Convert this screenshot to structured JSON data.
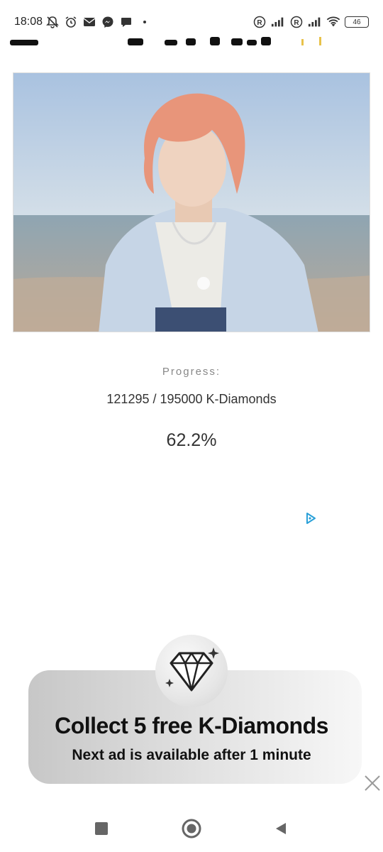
{
  "status_bar": {
    "time": "18:08",
    "battery": "46",
    "icons": [
      "bell-off-icon",
      "alarm-icon",
      "mail-icon",
      "messenger-icon",
      "chat-bubble-icon",
      "dot-icon",
      "registered-icon",
      "signal-icon",
      "registered-icon",
      "signal-icon",
      "wifi-icon",
      "battery-icon"
    ]
  },
  "progress": {
    "label": "Progress:",
    "count": "121295 / 195000 K-Diamonds",
    "percent": "62.2%"
  },
  "ad": {
    "reward_title": "Collect 5 free K-Diamonds",
    "reward_subtitle": "Next ad is available after 1 minute",
    "badge_icon": "diamond-icon",
    "close_icon": "close-icon",
    "adchoices_icon": "adchoices-icon"
  },
  "nav": {
    "icons": [
      "recents-square-icon",
      "home-circle-icon",
      "back-triangle-icon"
    ]
  },
  "colors": {
    "adchoices": "#2aa0d8",
    "card_dark": "#c7c7c7",
    "card_light": "#f7f7f7"
  }
}
